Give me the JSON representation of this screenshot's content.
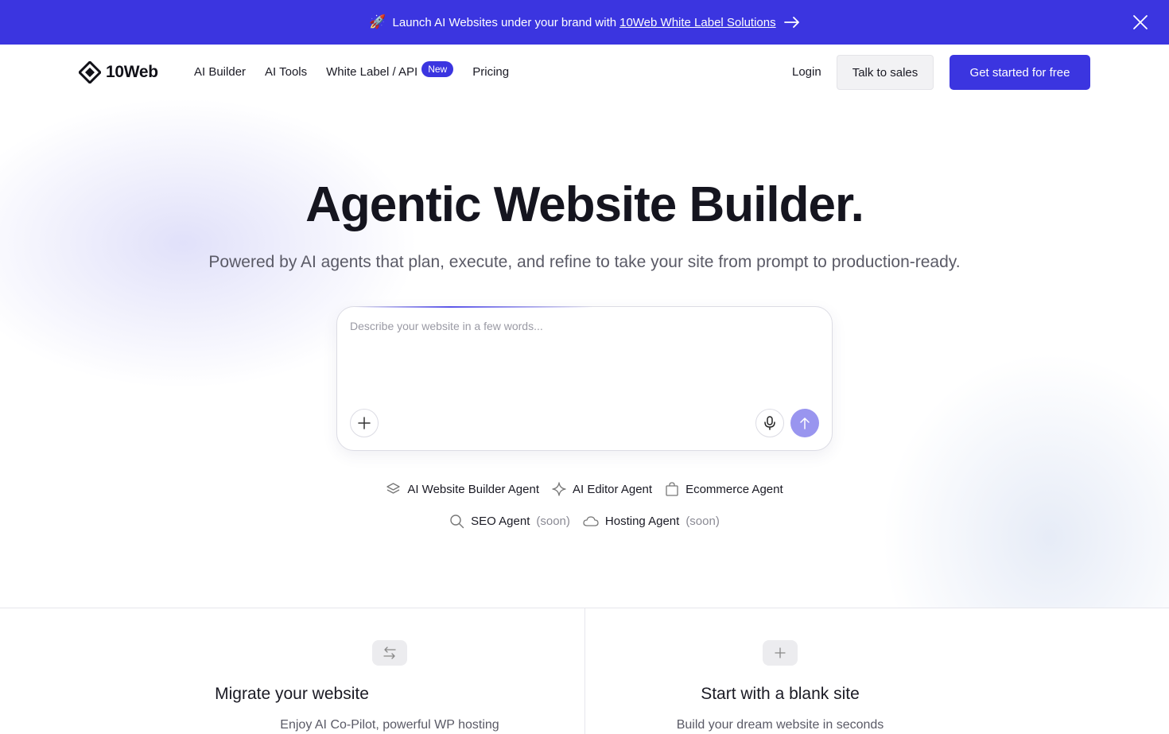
{
  "announcement": {
    "emoji": "🚀",
    "text": "Launch AI Websites under your brand with",
    "link_text": "10Web White Label Solutions",
    "bg_color": "#3b35e0",
    "arrow_icon": "arrow-right-icon",
    "close_icon": "close-icon"
  },
  "nav": {
    "logo_text": "10Web",
    "links": [
      {
        "label": "AI Builder"
      },
      {
        "label": "AI Tools"
      },
      {
        "label": "White Label / API",
        "badge": "New"
      },
      {
        "label": "Pricing"
      }
    ],
    "login": "Login",
    "talk_to_sales": "Talk to sales",
    "get_started": "Get started for free",
    "accent_color": "#3b35e0"
  },
  "hero": {
    "title": "Agentic Website Builder.",
    "subtitle": "Powered by AI agents that plan, execute, and refine to take your site from prompt to production-ready.",
    "prompt_placeholder": "Describe your website in a few words...",
    "prompt_buttons": [
      "plus-icon",
      "microphone-icon",
      "arrow-up-icon"
    ]
  },
  "agents": {
    "row1": [
      {
        "icon": "layers-icon",
        "label": "AI Website Builder Agent"
      },
      {
        "icon": "sparkle-icon",
        "label": "AI Editor Agent"
      },
      {
        "icon": "shopping-bag-icon",
        "label": "Ecommerce Agent"
      }
    ],
    "row2": [
      {
        "icon": "search-icon",
        "label": "SEO Agent",
        "status": "(soon)"
      },
      {
        "icon": "cloud-icon",
        "label": "Hosting Agent",
        "status": "(soon)"
      }
    ]
  },
  "cards": [
    {
      "icon": "swap-arrows-icon",
      "title": "Migrate your website",
      "description": "Enjoy AI Co-Pilot, powerful WP hosting"
    },
    {
      "icon": "plus-icon",
      "title": "Start with a blank site",
      "description": "Build your dream website in seconds"
    }
  ]
}
